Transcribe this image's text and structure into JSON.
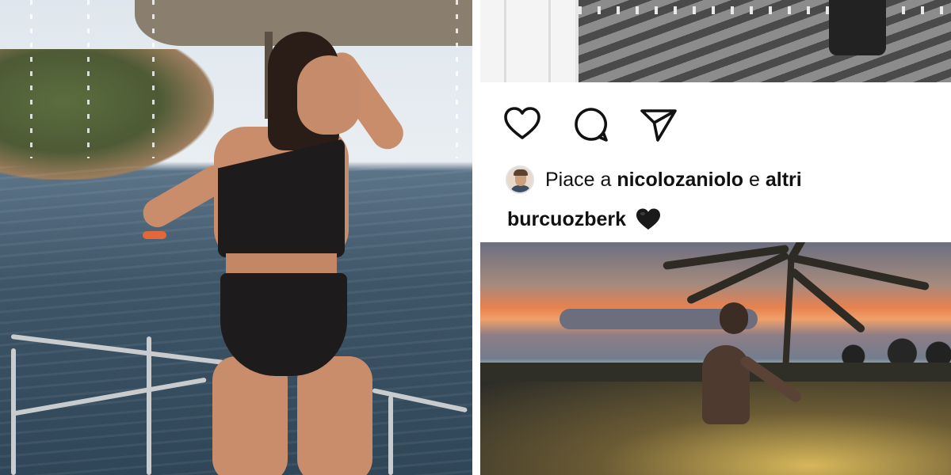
{
  "post": {
    "actions": {
      "like_icon": "heart-outline-icon",
      "comment_icon": "comment-bubble-icon",
      "share_icon": "paper-plane-icon"
    },
    "likes": {
      "prefix": "Piace a ",
      "user": "nicolozaniolo",
      "connector": " e ",
      "others": "altri"
    },
    "caption": {
      "username": "burcuozberk",
      "emoji_icon": "black-heart-emoji"
    }
  },
  "colors": {
    "text": "#111111",
    "background": "#ffffff",
    "swimsuit": "#1d1b1c",
    "sunset_orange": "#e7814f"
  }
}
